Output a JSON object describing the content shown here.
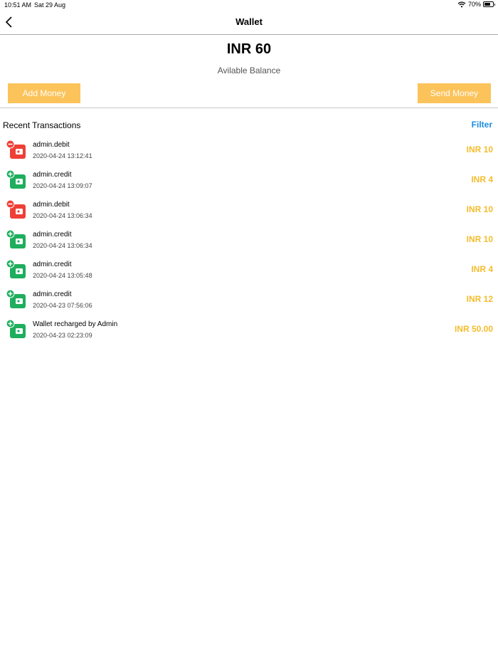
{
  "status_bar": {
    "time": "10:51 AM",
    "date": "Sat 29 Aug",
    "battery": "70%",
    "battery_level": 0.7
  },
  "nav": {
    "title": "Wallet"
  },
  "balance": {
    "amount": "INR 60",
    "label": "Avilable Balance"
  },
  "buttons": {
    "add_money": "Add Money",
    "send_money": "Send Money"
  },
  "transactions_header": {
    "title": "Recent Transactions",
    "filter": "Filter"
  },
  "colors": {
    "accent_yellow": "#fcc35a",
    "amount_yellow": "#f5bd2c",
    "debit_red": "#ef3f36",
    "credit_green": "#1fae5d",
    "filter_blue": "#1a8ce0"
  },
  "transactions": [
    {
      "type": "debit",
      "icon": "wallet-debit-icon",
      "title": "admin.debit",
      "datetime": "2020-04-24 13:12:41",
      "amount": "INR 10"
    },
    {
      "type": "credit",
      "icon": "wallet-credit-icon",
      "title": "admin.credit",
      "datetime": "2020-04-24 13:09:07",
      "amount": "INR 4"
    },
    {
      "type": "debit",
      "icon": "wallet-debit-icon",
      "title": "admin.debit",
      "datetime": "2020-04-24 13:06:34",
      "amount": "INR 10"
    },
    {
      "type": "credit",
      "icon": "wallet-credit-icon",
      "title": "admin.credit",
      "datetime": "2020-04-24 13:06:34",
      "amount": "INR 10"
    },
    {
      "type": "credit",
      "icon": "wallet-credit-icon",
      "title": "admin.credit",
      "datetime": "2020-04-24 13:05:48",
      "amount": "INR 4"
    },
    {
      "type": "credit",
      "icon": "wallet-credit-icon",
      "title": "admin.credit",
      "datetime": "2020-04-23 07:56:06",
      "amount": "INR 12"
    },
    {
      "type": "credit",
      "icon": "wallet-credit-icon",
      "title": "Wallet recharged by Admin",
      "datetime": "2020-04-23 02:23:09",
      "amount": "INR 50.00"
    }
  ]
}
